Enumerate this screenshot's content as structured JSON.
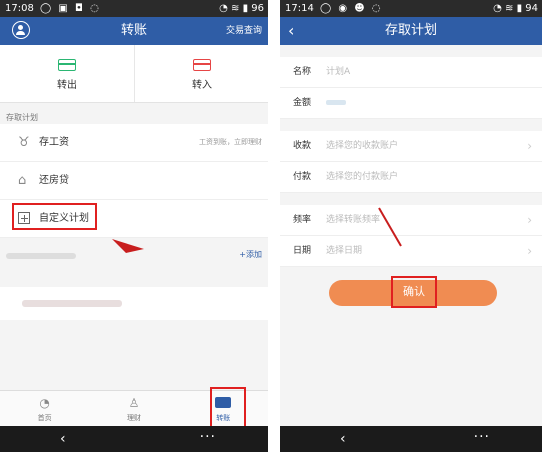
{
  "left": {
    "status": {
      "time": "17:08",
      "battery": "96"
    },
    "header": {
      "title": "转账",
      "right_link": "交易查询"
    },
    "transfer": {
      "out_label": "转出",
      "in_label": "转入"
    },
    "plans": {
      "section": "存取计划",
      "items": [
        {
          "label": "存工资",
          "desc": "工资到账，立即理财",
          "icon": "piggy-bank-icon"
        },
        {
          "label": "还房贷",
          "desc": "",
          "icon": "house-icon"
        },
        {
          "label": "自定义计划",
          "desc": "",
          "icon": "plus-square-icon"
        }
      ]
    },
    "accounts": {
      "add_label": "+添加"
    },
    "tabbar": [
      {
        "label": "首页",
        "icon": "clock-icon"
      },
      {
        "label": "理财",
        "icon": "bag-icon"
      },
      {
        "label": "转账",
        "icon": "card-icon"
      }
    ]
  },
  "right": {
    "status": {
      "time": "17:14",
      "battery": "94"
    },
    "header": {
      "title": "存取计划"
    },
    "form": {
      "name": {
        "label": "名称",
        "placeholder": "计划A"
      },
      "amount": {
        "label": "金额"
      },
      "receive": {
        "label": "收款",
        "placeholder": "选择您的收款账户"
      },
      "pay": {
        "label": "付款",
        "placeholder": "选择您的付款账户"
      },
      "freq": {
        "label": "频率",
        "placeholder": "选择转账频率"
      },
      "date": {
        "label": "日期",
        "placeholder": "选择日期"
      }
    },
    "confirm_label": "确认"
  },
  "colors": {
    "header": "#2f5da6",
    "confirm": "#f08c52",
    "highlight": "#e02020"
  }
}
